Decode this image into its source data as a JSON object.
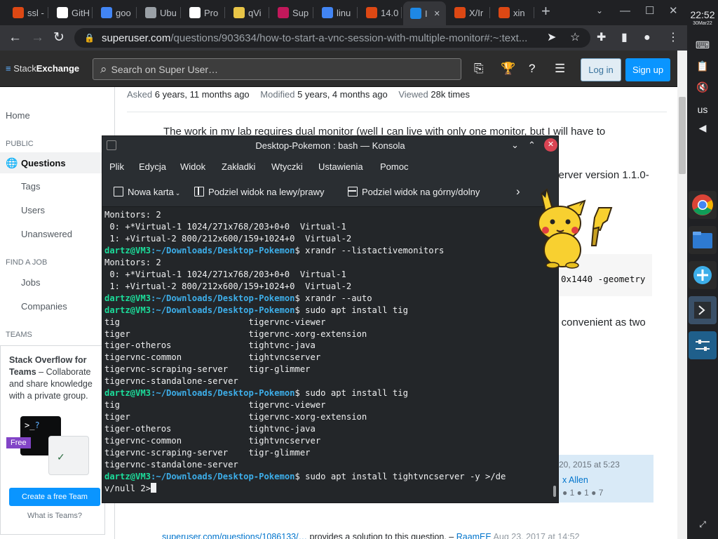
{
  "browser": {
    "tabs": [
      {
        "label": "ssl -",
        "icon": "ubuntu-icon",
        "color": "#dd4814"
      },
      {
        "label": "GitH",
        "icon": "github-icon",
        "color": "#ffffff"
      },
      {
        "label": "goo",
        "icon": "google-icon",
        "color": "#4285f4"
      },
      {
        "label": "Ubu",
        "icon": "globe-icon",
        "color": "#9aa0a6"
      },
      {
        "label": "Pro",
        "icon": "wikipedia-icon",
        "color": "#ffffff"
      },
      {
        "label": "qVi",
        "icon": "qvim-icon",
        "color": "#e8c547"
      },
      {
        "label": "Sup",
        "icon": "superuser-icon",
        "color": "#c2185b"
      },
      {
        "label": "linu",
        "icon": "google-icon",
        "color": "#4285f4"
      },
      {
        "label": "14.0",
        "icon": "askubuntu-icon",
        "color": "#dd4814"
      },
      {
        "label": "I",
        "icon": "superuser-icon",
        "color": "#1e88e5"
      },
      {
        "label": "X/Ir",
        "icon": "ubuntu-icon",
        "color": "#dd4814"
      },
      {
        "label": "xin",
        "icon": "askubuntu-icon",
        "color": "#dd4814"
      }
    ],
    "active_tab": 9,
    "url_domain": "superuser.com",
    "url_path": "/questions/903634/how-to-start-a-vnc-session-with-multiple-monitor#:~:text..."
  },
  "site": {
    "logo_a": "Stack",
    "logo_b": "Exchange",
    "search_placeholder": "Search on Super User…",
    "login": "Log in",
    "signup": "Sign up"
  },
  "nav": {
    "home": "Home",
    "public": "PUBLIC",
    "questions": "Questions",
    "tags": "Tags",
    "users": "Users",
    "unanswered": "Unanswered",
    "find_job": "FIND A JOB",
    "jobs": "Jobs",
    "companies": "Companies",
    "teams": "TEAMS",
    "teams_title": "Stack Overflow for Teams",
    "teams_desc": " – Collaborate and share knowledge with a private group.",
    "free": "Free",
    "teams_btn": "Create a free Team",
    "teams_what": "What is Teams?"
  },
  "question": {
    "asked_label": "Asked",
    "asked": "6 years, 11 months ago",
    "modified_label": "Modified",
    "modified": "5 years, 4 months ago",
    "viewed_label": "Viewed",
    "viewed": "28k times",
    "line1": "The work in my lab requires dual monitor (well I can live with only one monitor, but I will have to",
    "frag_server": "server version 1.1.0-",
    "frag_code": "0x1440 -geometry",
    "frag_convenient": "s convenient as two",
    "card_date": "20, 2015 at 5:23",
    "card_name": "x Allen",
    "card_badges": "● 1  ● 1  ● 7",
    "comment_link": "superuser.com/questions/1086133/…",
    "comment_text": " provides a solution to this question. – ",
    "comment_user": "RaamEE",
    "comment_date": " Aug 23, 2017 at 14:52"
  },
  "konsole": {
    "title": "Desktop-Pokemon : bash — Konsola",
    "menu": [
      "Plik",
      "Edycja",
      "Widok",
      "Zakładki",
      "Wtyczki",
      "Ustawienia",
      "Pomoc"
    ],
    "tools": {
      "new_tab": "Nowa karta",
      "split_lr": "Podziel widok na lewy/prawy",
      "split_tb": "Podziel widok na górny/dolny"
    },
    "terminal": [
      {
        "t": "Monitors: 2"
      },
      {
        "t": " 0: +*Virtual-1 1024/271x768/203+0+0  Virtual-1"
      },
      {
        "t": " 1: +Virtual-2 800/212x600/159+1024+0  Virtual-2"
      },
      {
        "u": "dartz@VM3",
        "p": ":~/Downloads/Desktop-Pokemon",
        "c": "$ xrandr --listactivemonitors"
      },
      {
        "t": "Monitors: 2"
      },
      {
        "t": " 0: +*Virtual-1 1024/271x768/203+0+0  Virtual-1"
      },
      {
        "t": " 1: +Virtual-2 800/212x600/159+1024+0  Virtual-2"
      },
      {
        "u": "dartz@VM3",
        "p": ":~/Downloads/Desktop-Pokemon",
        "c": "$ xrandr --auto"
      },
      {
        "u": "dartz@VM3",
        "p": ":~/Downloads/Desktop-Pokemon",
        "c": "$ sudo apt install tig"
      },
      {
        "t": "tig                         tigervnc-viewer"
      },
      {
        "t": "tiger                       tigervnc-xorg-extension"
      },
      {
        "t": "tiger-otheros               tightvnc-java"
      },
      {
        "t": "tigervnc-common             tightvncserver"
      },
      {
        "t": "tigervnc-scraping-server    tigr-glimmer"
      },
      {
        "t": "tigervnc-standalone-server"
      },
      {
        "u": "dartz@VM3",
        "p": ":~/Downloads/Desktop-Pokemon",
        "c": "$ sudo apt install tig"
      },
      {
        "t": "tig                         tigervnc-viewer"
      },
      {
        "t": "tiger                       tigervnc-xorg-extension"
      },
      {
        "t": "tiger-otheros               tightvnc-java"
      },
      {
        "t": "tigervnc-common             tightvncserver"
      },
      {
        "t": "tigervnc-scraping-server    tigr-glimmer"
      },
      {
        "t": "tigervnc-standalone-server"
      },
      {
        "u": "dartz@VM3",
        "p": ":~/Downloads/Desktop-Pokemon",
        "c": "$ sudo apt install tightvncserver -y >/de"
      },
      {
        "t": "v/null 2>",
        "cursor": true
      }
    ]
  },
  "shelf": {
    "time": "22:52",
    "date": "30Mar22",
    "locale": "us"
  }
}
